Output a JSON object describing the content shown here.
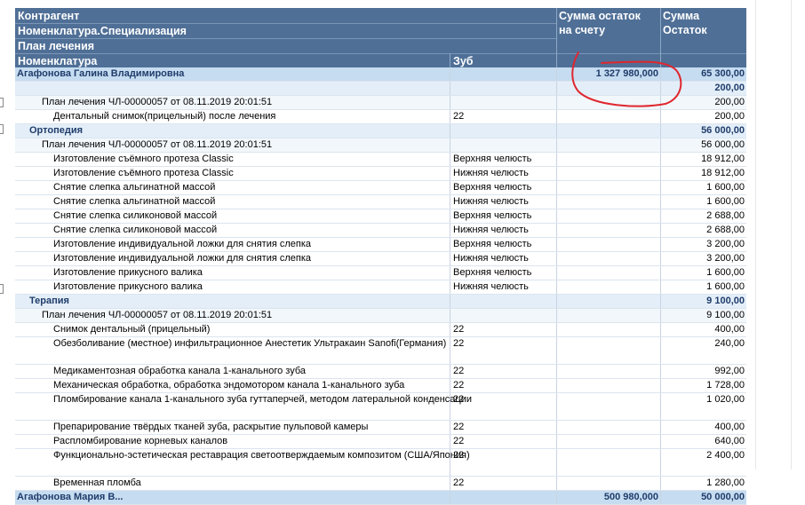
{
  "header": {
    "kontragent": "Контрагент",
    "nomenklatura_spec": "Номенклатура.Специализация",
    "plan": "План лечения",
    "nomenklatura": "Номенклатура",
    "zub": "Зуб",
    "summa_schet_line1": "Сумма остаток",
    "summa_schet_line2": "на счету",
    "summa_ostatok_line1": "Сумма",
    "summa_ostatok_line2": "Остаток"
  },
  "rows": [
    {
      "level": 0,
      "name": "Агафонова Галина Владимировна",
      "tooth": "",
      "acct": "1 327 980,000",
      "rest": "65 300,00"
    },
    {
      "level": 1,
      "name": "",
      "tooth": "",
      "acct": "",
      "rest": "200,00"
    },
    {
      "level": 2,
      "name": "План лечения ЧЛ-00000057 от 08.11.2019 20:01:51",
      "tooth": "",
      "acct": "",
      "rest": "200,00"
    },
    {
      "level": 3,
      "name": "Дентальный снимок(прицельный) после лечения",
      "tooth": "22",
      "acct": "",
      "rest": "200,00"
    },
    {
      "level": 1,
      "name": "Ортопедия",
      "tooth": "",
      "acct": "",
      "rest": "56 000,00"
    },
    {
      "level": 2,
      "name": "План лечения ЧЛ-00000057 от 08.11.2019 20:01:51",
      "tooth": "",
      "acct": "",
      "rest": "56 000,00"
    },
    {
      "level": 3,
      "name": "Изготовление съёмного протеза Classic",
      "tooth": "Верхняя челюсть",
      "acct": "",
      "rest": "18 912,00"
    },
    {
      "level": 3,
      "name": "Изготовление съёмного протеза Classic",
      "tooth": "Нижняя челюсть",
      "acct": "",
      "rest": "18 912,00"
    },
    {
      "level": 3,
      "name": "Снятие слепка альгинатной массой",
      "tooth": "Верхняя челюсть",
      "acct": "",
      "rest": "1 600,00"
    },
    {
      "level": 3,
      "name": "Снятие слепка альгинатной массой",
      "tooth": "Нижняя челюсть",
      "acct": "",
      "rest": "1 600,00"
    },
    {
      "level": 3,
      "name": "Снятие слепка силиконовой массой",
      "tooth": "Верхняя челюсть",
      "acct": "",
      "rest": "2 688,00"
    },
    {
      "level": 3,
      "name": "Снятие слепка силиконовой массой",
      "tooth": "Нижняя челюсть",
      "acct": "",
      "rest": "2 688,00"
    },
    {
      "level": 3,
      "name": "Изготовление индивидуальной ложки для снятия слепка",
      "tooth": "Верхняя челюсть",
      "acct": "",
      "rest": "3 200,00"
    },
    {
      "level": 3,
      "name": "Изготовление индивидуальной ложки для снятия слепка",
      "tooth": "Нижняя челюсть",
      "acct": "",
      "rest": "3 200,00"
    },
    {
      "level": 3,
      "name": "Изготовление прикусного валика",
      "tooth": "Верхняя челюсть",
      "acct": "",
      "rest": "1 600,00"
    },
    {
      "level": 3,
      "name": "Изготовление прикусного валика",
      "tooth": "Нижняя челюсть",
      "acct": "",
      "rest": "1 600,00"
    },
    {
      "level": 1,
      "name": "Терапия",
      "tooth": "",
      "acct": "",
      "rest": "9 100,00"
    },
    {
      "level": 2,
      "name": "План лечения ЧЛ-00000057 от 08.11.2019 20:01:51",
      "tooth": "",
      "acct": "",
      "rest": "9 100,00"
    },
    {
      "level": 3,
      "name": "Снимок дентальный (прицельный)",
      "tooth": "22",
      "acct": "",
      "rest": "400,00"
    },
    {
      "level": 3,
      "name": "Обезболивание (местное) инфильтрационное Анестетик Ультракаин Sanofi(Германия)",
      "tooth": "22",
      "acct": "",
      "rest": "240,00",
      "tall": true
    },
    {
      "level": 3,
      "name": "Медикаментозная обработка  канала 1-канального зуба",
      "tooth": "22",
      "acct": "",
      "rest": "992,00"
    },
    {
      "level": 3,
      "name": "Механическая обработка, обработка эндомотором канала 1-канального зуба",
      "tooth": "22",
      "acct": "",
      "rest": "1 728,00"
    },
    {
      "level": 3,
      "name": "Пломбирование канала 1-канального зуба гуттаперчей, методом латеральной конденсации",
      "tooth": "22",
      "acct": "",
      "rest": "1 020,00",
      "tall": true
    },
    {
      "level": 3,
      "name": "Препарирование твёрдых тканей зуба, раскрытие пульповой камеры",
      "tooth": "22",
      "acct": "",
      "rest": "400,00"
    },
    {
      "level": 3,
      "name": "Распломбирование корневых каналов",
      "tooth": "22",
      "acct": "",
      "rest": "640,00"
    },
    {
      "level": 3,
      "name": "Функционально-эстетическая реставрация светоотверждаемым композитом (США/Япония)",
      "tooth": "22",
      "acct": "",
      "rest": "2 400,00",
      "tall": true
    },
    {
      "level": 3,
      "name": "Временная пломба",
      "tooth": "22",
      "acct": "",
      "rest": "1 280,00"
    },
    {
      "level": 0,
      "name": "Агафонова Мария В...",
      "tooth": "",
      "acct": "500 980,000",
      "rest": "50 000,00"
    }
  ],
  "annotation_color": "#e0262e"
}
